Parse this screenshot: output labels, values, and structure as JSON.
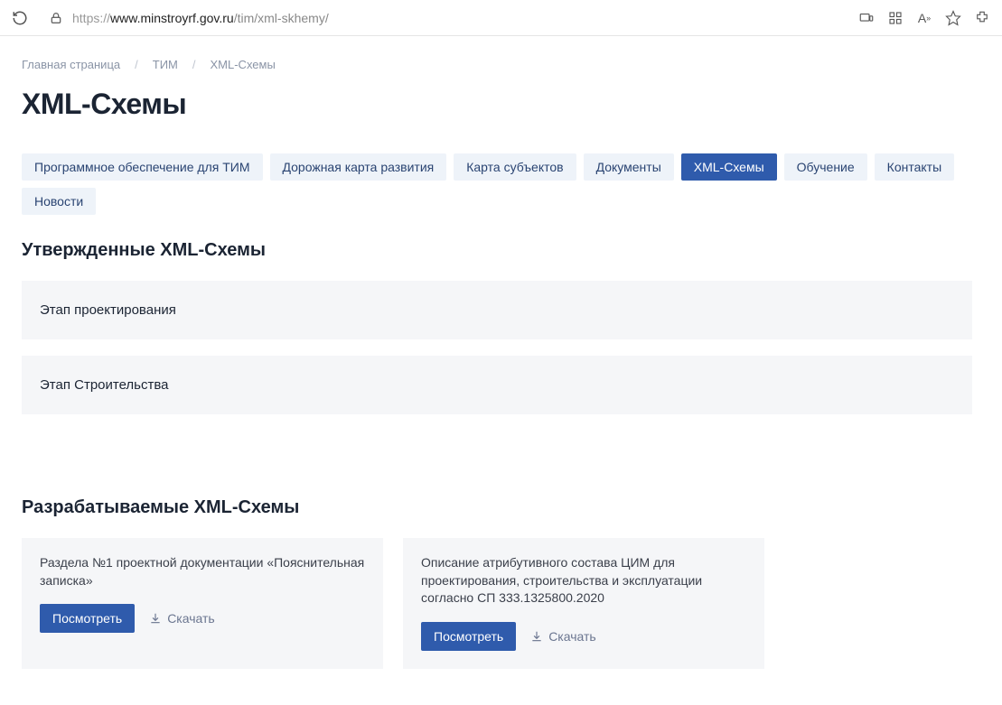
{
  "browser": {
    "url_proto": "https://",
    "url_host": "www.minstroyrf.gov.ru",
    "url_path": "/tim/xml-skhemy/"
  },
  "breadcrumbs": {
    "home": "Главная страница",
    "tim": "ТИМ",
    "current": "XML-Схемы"
  },
  "page_title": "XML-Схемы",
  "tabs": {
    "t0": "Программное обеспечение для ТИМ",
    "t1": "Дорожная карта развития",
    "t2": "Карта субъектов",
    "t3": "Документы",
    "t4": "XML-Схемы",
    "t5": "Обучение",
    "t6": "Контакты",
    "t7": "Новости"
  },
  "section_approved": {
    "title": "Утвержденные XML-Схемы",
    "panel1": "Этап проектирования",
    "panel2": "Этап Строительства"
  },
  "section_dev": {
    "title": "Разрабатываемые XML-Схемы",
    "card1_text": "Раздела №1 проектной документации «Пояснительная записка»",
    "card2_text": "Описание атрибутивного состава ЦИМ для проектирования, строительства и эксплуатации согласно СП 333.1325800.2020",
    "view_label": "Посмотреть",
    "download_label": "Скачать"
  }
}
